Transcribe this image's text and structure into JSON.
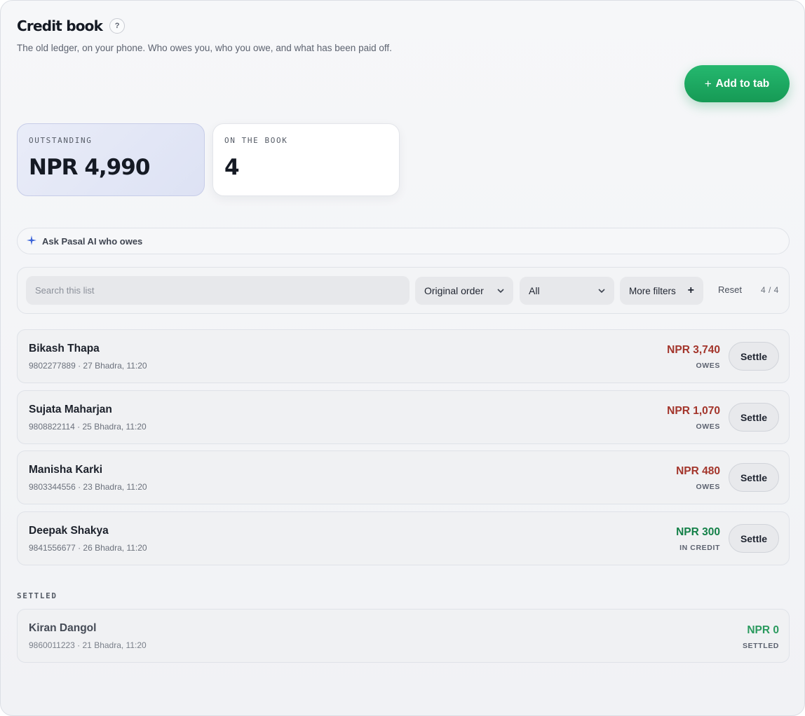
{
  "header": {
    "title": "Credit book",
    "help_icon_glyph": "?",
    "subtitle": "The old ledger, on your phone. Who owes you, who you owe, and what has been paid off."
  },
  "actions": {
    "add_glyph": "+",
    "add_label": "Add to tab"
  },
  "stats": {
    "outstanding_label": "OUTSTANDING",
    "outstanding_value": "NPR 4,990",
    "onbook_label": "ON THE BOOK",
    "onbook_value": "4"
  },
  "ask": {
    "icon": "sparkle-icon",
    "label": "Ask Pasal AI who owes"
  },
  "filters": {
    "search_placeholder": "Search this list",
    "order_value": "Original order",
    "status_value": "All",
    "more_label": "More filters",
    "reset_label": "Reset",
    "count": "4 / 4"
  },
  "entries": [
    {
      "name": "Bikash Thapa",
      "meta": "9802277889 · 27 Bhadra, 11:20",
      "amount": "NPR 3,740",
      "status": "OWES",
      "settle": "Settle"
    },
    {
      "name": "Sujata Maharjan",
      "meta": "9808822114 · 25 Bhadra, 11:20",
      "amount": "NPR 1,070",
      "status": "OWES",
      "settle": "Settle"
    },
    {
      "name": "Manisha Karki",
      "meta": "9803344556 · 23 Bhadra, 11:20",
      "amount": "NPR 480",
      "status": "OWES",
      "settle": "Settle"
    },
    {
      "name": "Deepak Shakya",
      "meta": "9841556677 · 26 Bhadra, 11:20",
      "amount": "NPR 300",
      "status": "IN CREDIT",
      "settle": "Settle"
    }
  ],
  "settled": {
    "section_label": "SETTLED",
    "items": [
      {
        "name": "Kiran Dangol",
        "meta": "9860011223 · 21 Bhadra, 11:20",
        "amount": "NPR 0",
        "status": "SETTLED"
      }
    ]
  },
  "colors": {
    "accent_green": "#1fae62",
    "owes_red": "#a3352b",
    "credit_green": "#148048",
    "settled_green": "#2a9a5e"
  }
}
